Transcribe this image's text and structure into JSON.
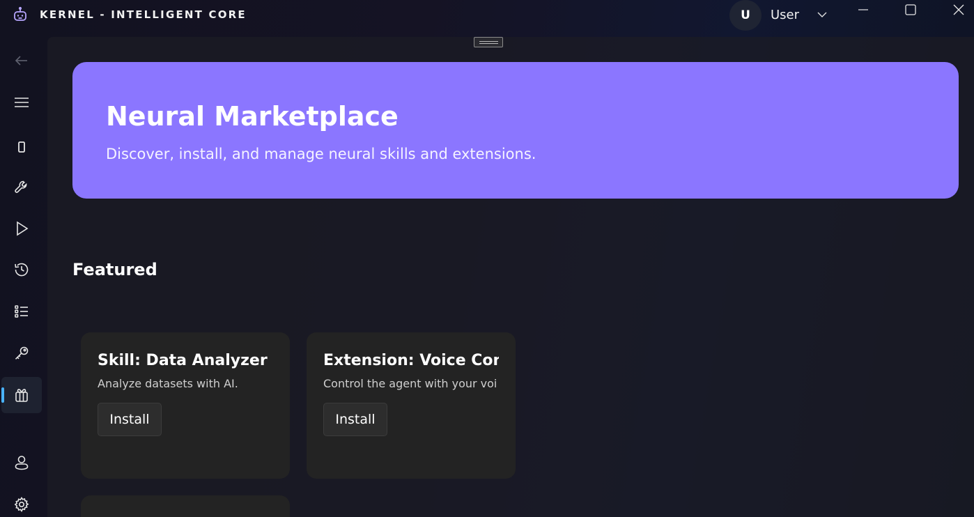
{
  "app": {
    "title": "KERNEL - INTELLIGENT CORE"
  },
  "user": {
    "initial": "U",
    "name": "User"
  },
  "sidebar": {
    "items": [
      {
        "name": "back-icon"
      },
      {
        "name": "menu-icon"
      },
      {
        "name": "device-icon"
      },
      {
        "name": "wrench-icon"
      },
      {
        "name": "play-icon"
      },
      {
        "name": "history-icon"
      },
      {
        "name": "task-list-icon"
      },
      {
        "name": "key-icon"
      },
      {
        "name": "gift-icon",
        "active": true
      },
      {
        "name": "person-icon"
      },
      {
        "name": "gear-icon"
      }
    ],
    "accent_color": "#4ab3ff"
  },
  "hero": {
    "title": "Neural Marketplace",
    "subtitle": "Discover, install, and manage neural skills and extensions.",
    "color": "#8b76ff"
  },
  "featured": {
    "title": "Featured",
    "cards": [
      {
        "title": "Skill: Data Analyzer",
        "description": "Analyze datasets with AI.",
        "button": "Install"
      },
      {
        "title": "Extension: Voice Contr",
        "description": "Control the agent with your voi",
        "button": "Install"
      }
    ]
  }
}
